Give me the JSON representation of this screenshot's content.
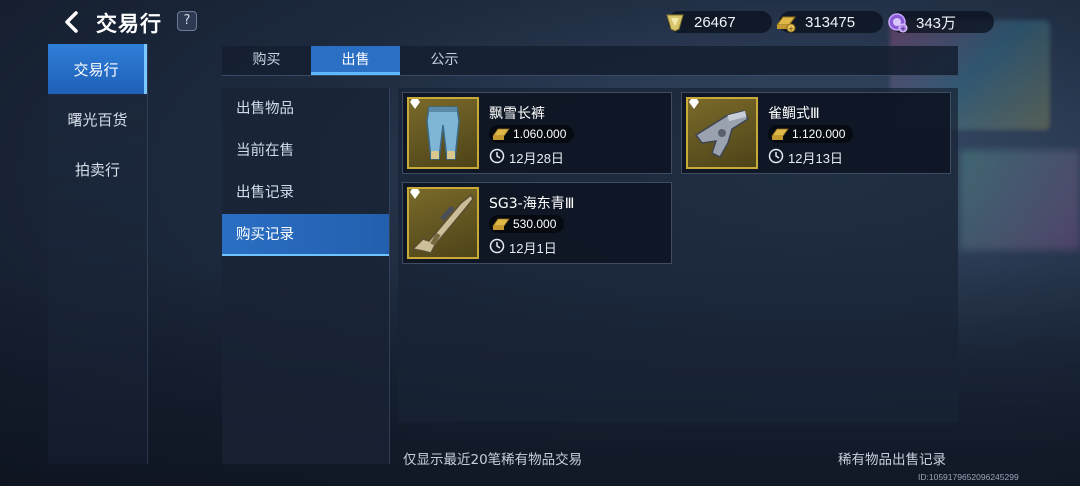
{
  "header": {
    "title": "交易行",
    "help_label": "?"
  },
  "currencies": [
    {
      "icon": "diamond-token-icon",
      "value": "26467"
    },
    {
      "icon": "gold-bar-icon",
      "value": "313475"
    },
    {
      "icon": "purple-orb-icon",
      "value": "343万"
    }
  ],
  "leftnav": {
    "items": [
      {
        "label": "交易行",
        "active": true
      },
      {
        "label": "曙光百货",
        "active": false
      },
      {
        "label": "拍卖行",
        "active": false
      }
    ]
  },
  "tabs": [
    {
      "label": "购买",
      "active": false
    },
    {
      "label": "出售",
      "active": true
    },
    {
      "label": "公示",
      "active": false
    }
  ],
  "submenu": {
    "items": [
      {
        "label": "出售物品",
        "active": false
      },
      {
        "label": "当前在售",
        "active": false
      },
      {
        "label": "出售记录",
        "active": false
      },
      {
        "label": "购买记录",
        "active": true
      }
    ]
  },
  "records": [
    {
      "name": "飘雪长裤",
      "price": "1.060.000",
      "date": "12月28日",
      "icon": "pants-icon"
    },
    {
      "name": "雀鲷式Ⅲ",
      "price": "1.120.000",
      "date": "12月13日",
      "icon": "pistol-icon"
    },
    {
      "name": "SG3-海东青Ⅲ",
      "price": "530.000",
      "date": "12月1日",
      "icon": "sniper-rifle-icon"
    }
  ],
  "footer": {
    "note": "仅显示最近20笔稀有物品交易",
    "link": "稀有物品出售记录",
    "uid": "ID:1059179652096245299"
  },
  "colors": {
    "accent": "#2a6fc4",
    "accent_light": "#5fb8ff",
    "rare_frame": "#c9a938"
  }
}
